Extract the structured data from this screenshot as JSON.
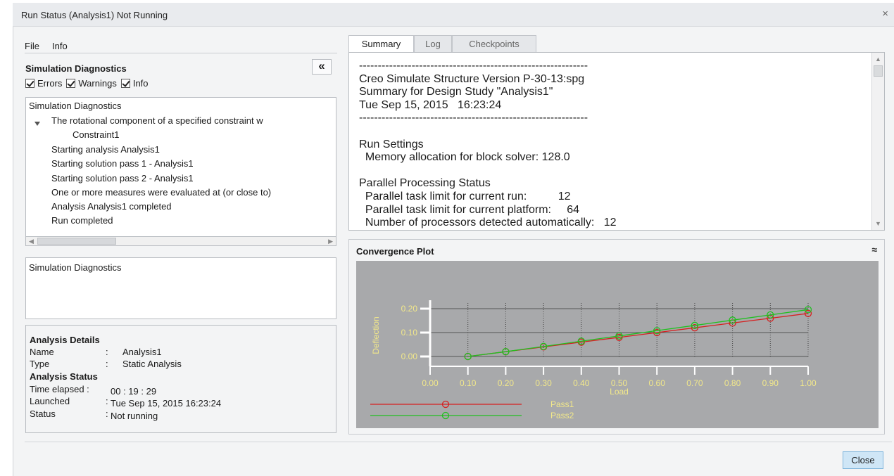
{
  "window": {
    "title": "Run Status (Analysis1) Not Running",
    "close_glyph": "×"
  },
  "menu": {
    "file": "File",
    "info": "Info"
  },
  "diagnostics": {
    "title": "Simulation Diagnostics",
    "collapse_glyph": "«",
    "filters": [
      {
        "label": "Errors",
        "checked": true
      },
      {
        "label": "Warnings",
        "checked": true
      },
      {
        "label": "Info",
        "checked": true
      }
    ],
    "tree": [
      "Simulation Diagnostics",
      "The rotational component of a specified constraint w",
      "Constraint1",
      "Starting analysis Analysis1",
      "Starting solution pass 1 - Analysis1",
      "Starting solution pass 2 - Analysis1",
      "One or more measures were evaluated at (or close to)",
      "Analysis Analysis1 completed",
      "Run completed"
    ],
    "detail_box_label": "Simulation Diagnostics"
  },
  "analysis_details": {
    "heading": "Analysis Details",
    "name_label": "Name",
    "name_sep": ":",
    "name_value": "Analysis1",
    "type_label": "Type",
    "type_sep": ":",
    "type_value": "Static Analysis",
    "status_heading": "Analysis Status",
    "elapsed_label": "Time elapsed :",
    "elapsed_value": "00 : 19 : 29",
    "launched_label": "Launched",
    "launched_sep": ":",
    "launched_value": "Tue Sep 15, 2015  16:23:24",
    "status_label": "Status",
    "status_sep": ":",
    "status_value": "Not running"
  },
  "tabs": [
    "Summary",
    "Log",
    "Checkpoints"
  ],
  "summary_text": "-------------------------------------------------------------\nCreo Simulate Structure Version P-30-13:spg\nSummary for Design Study \"Analysis1\"\nTue Sep 15, 2015   16:23:24\n-------------------------------------------------------------\n\nRun Settings\n  Memory allocation for block solver: 128.0\n\nParallel Processing Status\n  Parallel task limit for current run:          12\n  Parallel task limit for current platform:     64\n  Number of processors detected automatically:   12",
  "convergence": {
    "title": "Convergence Plot",
    "collapse_glyph": "≈"
  },
  "chart_data": {
    "type": "line",
    "xlabel": "Load",
    "ylabel": "Deflection",
    "xlim": [
      0,
      1
    ],
    "ylim": [
      0,
      0.2
    ],
    "x_ticks": [
      "0.00",
      "0.10",
      "0.20",
      "0.30",
      "0.40",
      "0.50",
      "0.60",
      "0.70",
      "0.80",
      "0.90",
      "1.00"
    ],
    "y_ticks": [
      "0.00",
      "0.10",
      "0.20"
    ],
    "x": [
      0.1,
      0.2,
      0.3,
      0.4,
      0.5,
      0.6,
      0.7,
      0.8,
      0.9,
      1.0
    ],
    "series": [
      {
        "name": "Pass1",
        "color": "#d62020",
        "values": [
          0.0,
          0.02,
          0.04,
          0.06,
          0.08,
          0.1,
          0.12,
          0.14,
          0.16,
          0.18
        ]
      },
      {
        "name": "Pass2",
        "color": "#20c020",
        "values": [
          0.0,
          0.02,
          0.042,
          0.064,
          0.086,
          0.108,
          0.13,
          0.152,
          0.174,
          0.196
        ]
      }
    ],
    "grid": true,
    "legend": "bottom-left",
    "background": "#a8a9ab",
    "label_color": "#f2e88a"
  },
  "footer": {
    "close_label": "Close"
  }
}
